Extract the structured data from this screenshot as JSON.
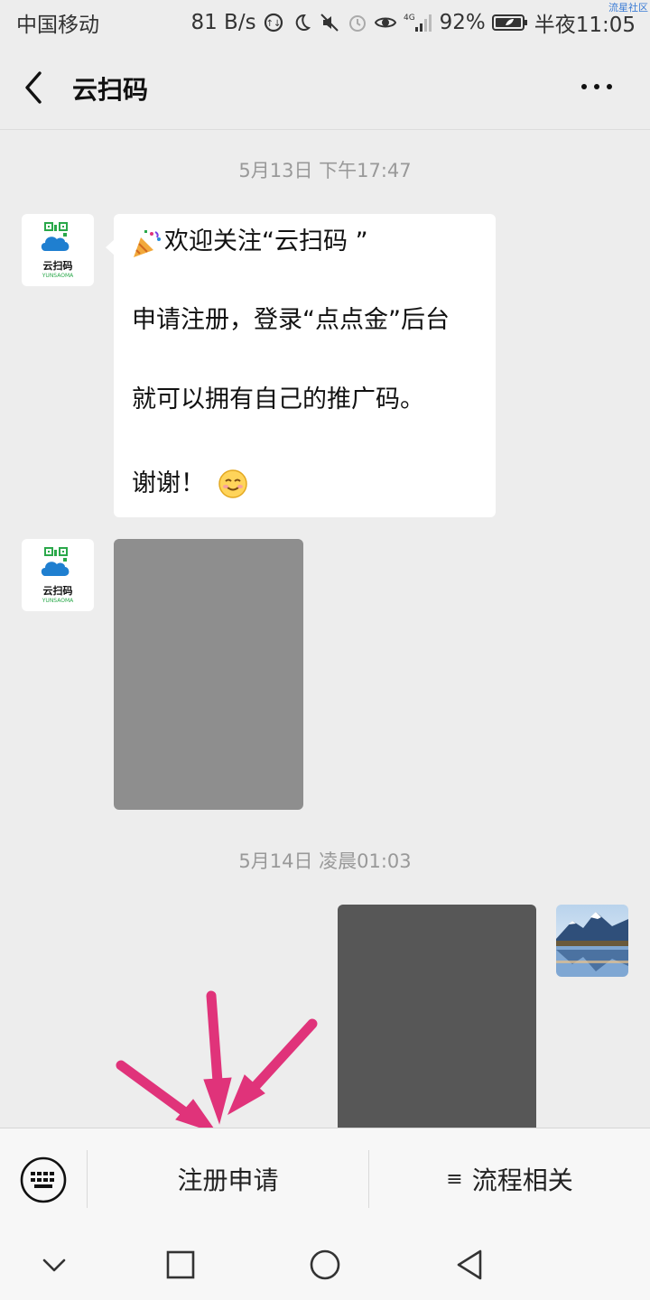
{
  "status_bar": {
    "carrier": "中国移动",
    "speed": "81 B/s",
    "network": "4G",
    "battery": "92%",
    "time": "半夜11:05",
    "watermark": "流星社区"
  },
  "header": {
    "title": "云扫码",
    "back_icon": "chevron-left-icon",
    "more_icon": "more-dots-icon"
  },
  "chat": {
    "time_1": "5月13日 下午17:47",
    "time_2": "5月14日 凌晨01:03",
    "brand_avatar": {
      "text": "云扫码",
      "sub": "YUNSAOMA"
    },
    "welcome_message": {
      "line1": "欢迎关注“云扫码 ”",
      "line2": "申请注册，登录“点点金”后台",
      "line3": "就可以拥有自己的推广码。",
      "line4": "谢谢！"
    }
  },
  "bottom_menu": {
    "keyboard_icon": "keyboard-icon",
    "item1": "注册申请",
    "item2": "流程相关",
    "item2_icon": "≡"
  },
  "nav": {
    "icons": [
      "chevron-down-icon",
      "square-icon",
      "circle-icon",
      "triangle-back-icon"
    ]
  },
  "colors": {
    "background": "#ededed",
    "arrow": "#e0337a",
    "bubble": "#ffffff"
  }
}
